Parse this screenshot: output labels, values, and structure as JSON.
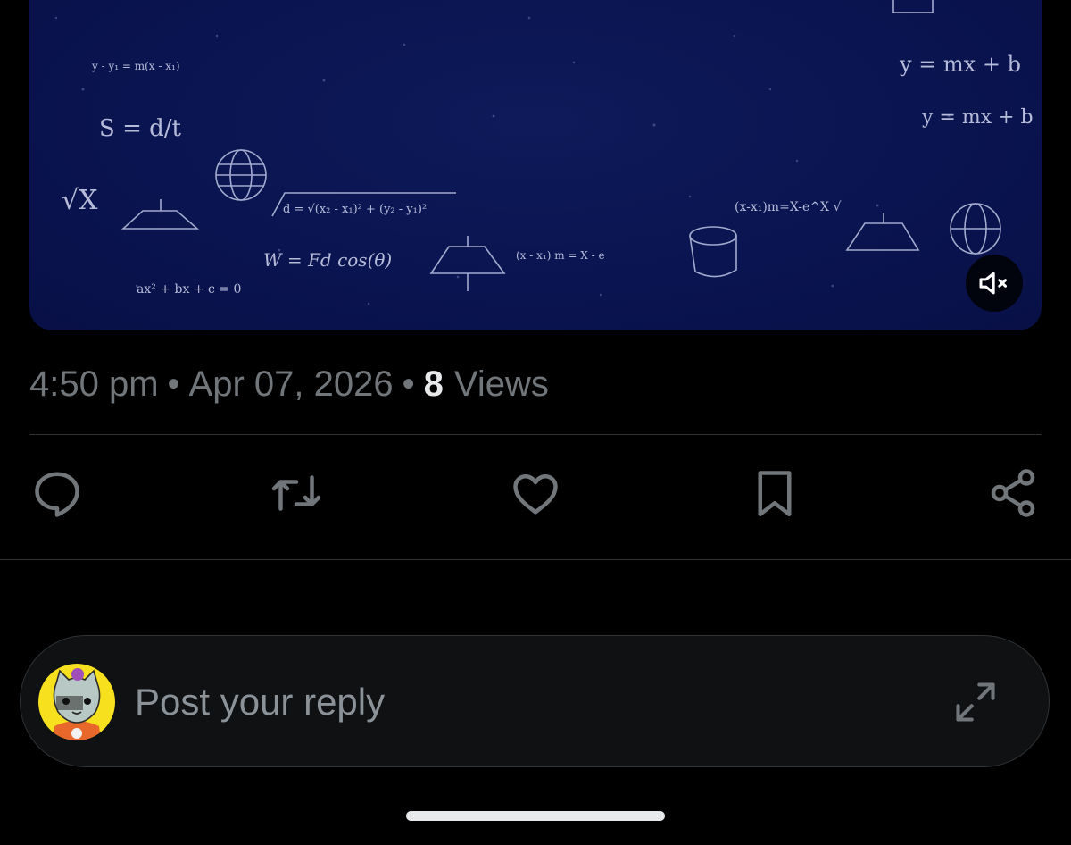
{
  "post": {
    "media": {
      "kind": "video",
      "mute_icon": "volume-muted-icon",
      "formulas": {
        "f1": "y = mx + b",
        "f2": "y = mx + b",
        "f3": "y - y₁ = m(x - x₁)",
        "f4": "S = d/t",
        "f5": "√X",
        "f6": "W = Fd cos(θ)",
        "f7": "ax² + bx + c = 0",
        "f8": "d = √(x₂ - x₁)² + (y₂ - y₁)²",
        "f9": "(x - x₁) m = X - e",
        "f10": "(x-x₁)m=X-e^X √"
      }
    },
    "time": "4:50 pm",
    "separator": "•",
    "date": "Apr 07, 2026",
    "views_count": "8",
    "views_label": "Views"
  },
  "actions": [
    {
      "name": "reply",
      "icon": "speech-bubble-icon"
    },
    {
      "name": "repost",
      "icon": "repost-arrows-icon"
    },
    {
      "name": "like",
      "icon": "heart-icon"
    },
    {
      "name": "bookmark",
      "icon": "bookmark-icon"
    },
    {
      "name": "share",
      "icon": "share-nodes-icon"
    }
  ],
  "composer": {
    "placeholder": "Post your reply",
    "avatar_icon": "cat-avatar-icon",
    "expand_icon": "expand-arrows-icon"
  },
  "colors": {
    "background": "#000000",
    "muted_text": "#71767b",
    "primary_text": "#e7e9ea",
    "divider": "#2f3336",
    "media_bg": "#0a1450",
    "avatar_bg": "#f7e01d"
  }
}
